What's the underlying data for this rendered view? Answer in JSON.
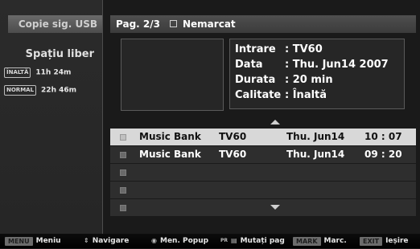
{
  "left": {
    "header": "Copie sig. USB",
    "space_title": "Spațiu liber",
    "quality": [
      {
        "badge": "ÎNALTĂ",
        "value": "11h 24m"
      },
      {
        "badge": "NORMAL",
        "value": "22h 46m"
      }
    ]
  },
  "top": {
    "page": "Pag. 2/3",
    "unmarked": "Nemarcat"
  },
  "info": {
    "rows": [
      {
        "key": "Intrare",
        "value": ": TV60"
      },
      {
        "key": "Data",
        "value": ":  Thu. Jun14 2007"
      },
      {
        "key": "Durata",
        "value": ": 20 min"
      },
      {
        "key": "Calitate",
        "value": ": Înaltă"
      }
    ]
  },
  "list": [
    {
      "title": "Music Bank",
      "channel": "TV60",
      "date": "Thu. Jun14",
      "time": "10 : 07",
      "selected": true
    },
    {
      "title": "Music Bank",
      "channel": "TV60",
      "date": "Thu. Jun14",
      "time": "09 : 20",
      "selected": false
    },
    {
      "title": "",
      "channel": "",
      "date": "",
      "time": "",
      "selected": false
    },
    {
      "title": "",
      "channel": "",
      "date": "",
      "time": "",
      "selected": false
    },
    {
      "title": "",
      "channel": "",
      "date": "",
      "time": "",
      "selected": false
    }
  ],
  "bottom": {
    "menu_key": "MENU",
    "menu_label": "Meniu",
    "nav_label": "Navigare",
    "popup_label": "Men. Popup",
    "pr_key": "PR",
    "move_label": "Mutați pag",
    "mark_key": "MARK",
    "mark_label": "Marc.",
    "exit_key": "EXIT",
    "exit_label": "Ieșire"
  }
}
